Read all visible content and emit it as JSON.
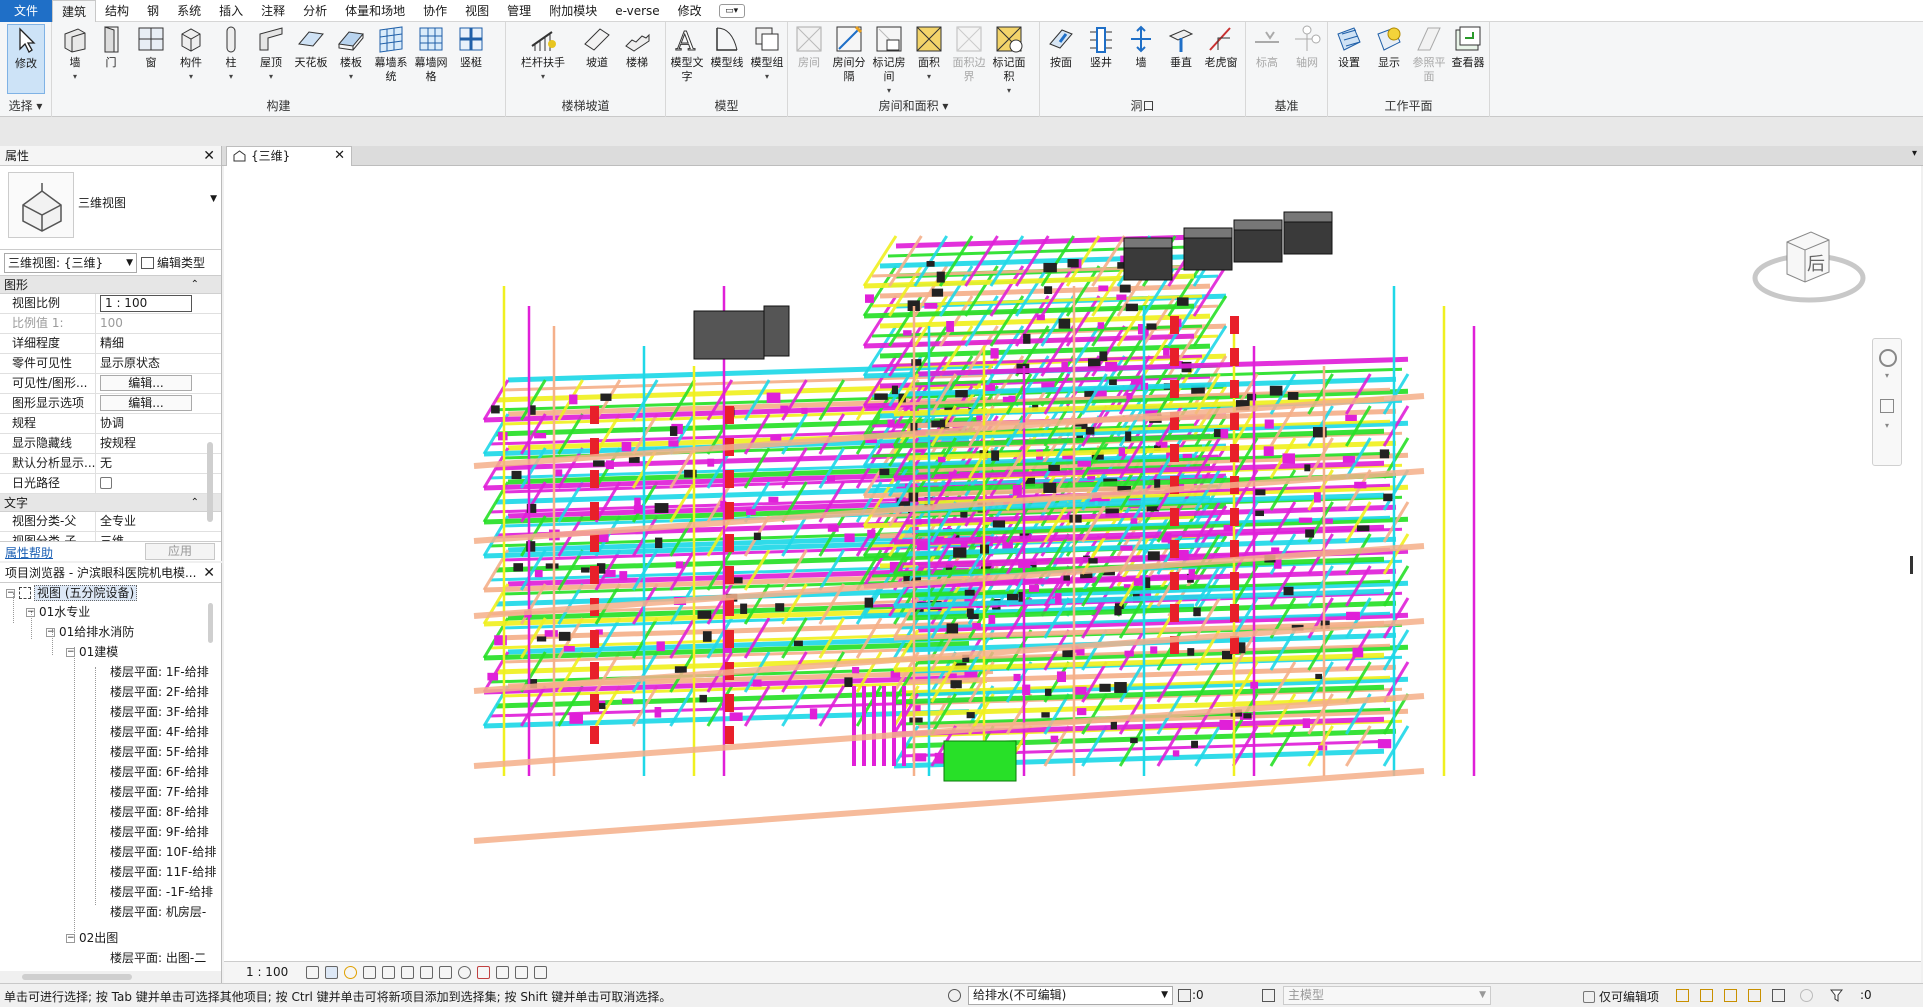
{
  "menu": {
    "tabs": [
      "文件",
      "建筑",
      "结构",
      "钢",
      "系统",
      "插入",
      "注释",
      "分析",
      "体量和场地",
      "协作",
      "视图",
      "管理",
      "附加模块",
      "e-verse",
      "修改"
    ],
    "active": "建筑"
  },
  "ribbon": {
    "select_label": "选择",
    "panels": {
      "build": "构建",
      "circulation": "楼梯坡道",
      "model": "模型",
      "room": "房间和面积",
      "opening": "洞口",
      "datum": "基准",
      "workplane": "工作平面"
    },
    "tools": {
      "modify": "修改",
      "wall": "墙",
      "door": "门",
      "window": "窗",
      "component": "构件",
      "column": "柱",
      "roof": "屋顶",
      "ceiling": "天花板",
      "floor": "楼板",
      "curtain_system": "幕墙系统",
      "curtain_grid": "幕墙网格",
      "mullion": "竖梃",
      "railing": "栏杆扶手",
      "ramp": "坡道",
      "stair": "楼梯",
      "model_text": "模型文字",
      "model_line": "模型线",
      "model_group": "模型组",
      "room": "房间",
      "room_separator": "房间分隔",
      "tag_room": "标记房间",
      "area": "面积",
      "area_boundary": "面积边界",
      "tag_area": "标记面积",
      "by_face": "按面",
      "shaft": "竖井",
      "wall_opening": "墙",
      "vertical": "垂直",
      "dormer": "老虎窗",
      "level": "标高",
      "grid": "轴网",
      "set": "设置",
      "show": "显示",
      "ref_plane": "参照平面",
      "viewer": "查看器"
    }
  },
  "properties": {
    "title": "属性",
    "type_name": "三维视图",
    "view_selector": "三维视图: {三维}",
    "edit_type": "编辑类型",
    "groups": [
      {
        "name": "图形",
        "rows": [
          {
            "k": "视图比例",
            "v": "1 : 100"
          },
          {
            "k": "比例值 1:",
            "v": "100"
          },
          {
            "k": "详细程度",
            "v": "精细"
          },
          {
            "k": "零件可见性",
            "v": "显示原状态"
          },
          {
            "k": "可见性/图形...",
            "v": "编辑..."
          },
          {
            "k": "图形显示选项",
            "v": "编辑..."
          },
          {
            "k": "规程",
            "v": "协调"
          },
          {
            "k": "显示隐藏线",
            "v": "按规程"
          },
          {
            "k": "默认分析显示...",
            "v": "无"
          },
          {
            "k": "日光路径",
            "v": ""
          }
        ]
      },
      {
        "name": "文字",
        "rows": [
          {
            "k": "视图分类-父",
            "v": "全专业"
          },
          {
            "k": "视图分类-子",
            "v": "三维"
          }
        ]
      }
    ],
    "help": "属性帮助",
    "apply": "应用"
  },
  "browser": {
    "title": "项目浏览器 - 沪滨眼科医院机电模...",
    "root": "视图 (五分院设备)",
    "l1": "01水专业",
    "l2": "01给排水消防",
    "l3": "01建模",
    "plans": [
      "楼层平面: 1F-给排",
      "楼层平面: 2F-给排",
      "楼层平面: 3F-给排",
      "楼层平面: 4F-给排",
      "楼层平面: 5F-给排",
      "楼层平面: 6F-给排",
      "楼层平面: 7F-给排",
      "楼层平面: 8F-给排",
      "楼层平面: 9F-给排",
      "楼层平面: 10F-给排",
      "楼层平面: 11F-给排",
      "楼层平面: -1F-给排",
      "楼层平面: 机房层-"
    ],
    "l3b": "02出图",
    "plan_b": "楼层平面: 出图-二"
  },
  "view": {
    "tab_label": "{三维}",
    "scale": "1 : 100",
    "viewcube_face": "后"
  },
  "status": {
    "text": "单击可进行选择; 按 Tab 键并单击可选择其他项目; 按 Ctrl 键并单击可将新项目添加到选择集; 按 Shift 键并单击可取消选择。",
    "workset": "给排水(不可编辑)",
    "workset_count": ":0",
    "model": "主模型",
    "editable_only": "仅可编辑项",
    "filter_count": ":0"
  },
  "colors": {
    "accent": "#1f6fc7",
    "selection": "#cde3f7",
    "pipe_cyan": "#1fd8e8",
    "pipe_magenta": "#e020d8",
    "pipe_green": "#28e028",
    "pipe_yellow": "#f0f020",
    "pipe_red": "#e8202a",
    "pipe_salmon": "#f5b08a"
  }
}
